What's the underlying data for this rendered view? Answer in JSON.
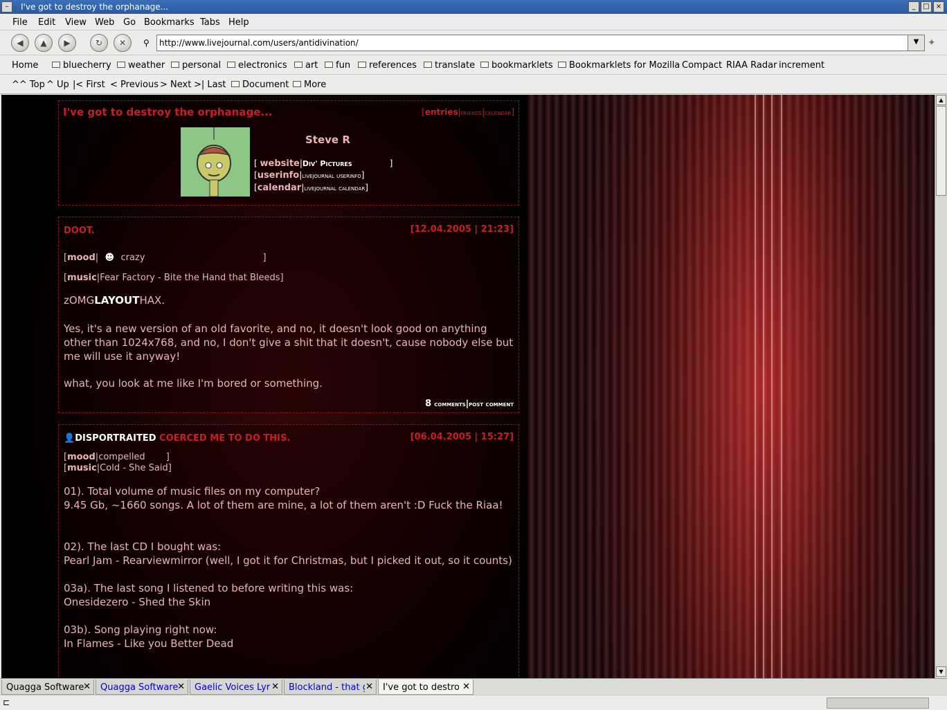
{
  "window": {
    "title": "I've got to destroy the orphanage..."
  },
  "menu": [
    "File",
    "Edit",
    "View",
    "Web",
    "Go",
    "Bookmarks",
    "Tabs",
    "Help"
  ],
  "nav": {
    "url": "http://www.livejournal.com/users/antidivination/"
  },
  "bookmarks": {
    "home": "Home",
    "folders": [
      "bluecherry",
      "weather",
      "personal",
      "electronics",
      "art",
      "fun",
      "references",
      "translate",
      "bookmarklets",
      "Bookmarklets for Mozilla"
    ],
    "links": [
      "Compact",
      "RIAA Radar",
      "increment"
    ]
  },
  "sitenav": {
    "top": "^^ Top",
    "up": "^ Up",
    "first": "|< First",
    "previous": "< Previous",
    "next": "> Next",
    "last": ">| Last",
    "document": "Document",
    "more": "More"
  },
  "header": {
    "journal_title": "I've got to destroy the orphanage...",
    "entries": "entries",
    "friends": "friends",
    "calendar": "calendar",
    "user_name": "Steve R",
    "rows": [
      {
        "key": "website",
        "value": "Div' Pictures"
      },
      {
        "key": "userinfo",
        "value": "livejournal userinfo"
      },
      {
        "key": "calendar",
        "value": "livejournal calendar"
      }
    ]
  },
  "post1": {
    "title": "DOOT.",
    "date": "[12.04.2005 | 21:23]",
    "mood_label": "mood",
    "mood": "crazy",
    "music_label": "music",
    "music": "Fear Factory - Bite the Hand that Bleeds",
    "body_pre": "zOMG",
    "body_bold": "LAYOUT",
    "body_post": "HAX.",
    "p1": "Yes, it's a new version of an old favorite, and no, it doesn't look good on anything other than 1024x768, and no, I don't give a shit that it doesn't, cause nobody else but me will use it anyway!",
    "p2": "what, you look at me like I'm bored or something.",
    "comments_count": "8",
    "comments": "comments",
    "post_comment": "post comment"
  },
  "post2": {
    "user": "DISPORTRAITED",
    "title": "COERCED ME TO DO THIS.",
    "date": "[06.04.2005 | 15:27]",
    "mood_label": "mood",
    "mood": "compelled",
    "music_label": "music",
    "music": "Cold - She Said",
    "q1": "01). Total volume of music files on my computer?",
    "a1": "9.45 Gb, ~1660 songs. A lot of them are mine, a lot of them aren't :D Fuck the Riaa!",
    "q2": "02). The last CD I bought was:",
    "a2": "Pearl Jam - Rearviewmirror (well, I got it for Christmas, but I picked it out, so it counts)",
    "q3": "03a). The last song I listened to before writing this was:",
    "a3": "Onesidezero - Shed the Skin",
    "q4": "03b). Song playing right now:",
    "a4": "In Flames - Like you Better Dead"
  },
  "tabs": [
    "Quagga Software",
    "Quagga Software",
    "Gaelic Voices Lyri",
    "Blockland - that g",
    "I've got to destro"
  ],
  "colors": {
    "accent_red": "#c62024",
    "text_pink": "#e8b4b4",
    "border_red": "#8a1a1a"
  }
}
